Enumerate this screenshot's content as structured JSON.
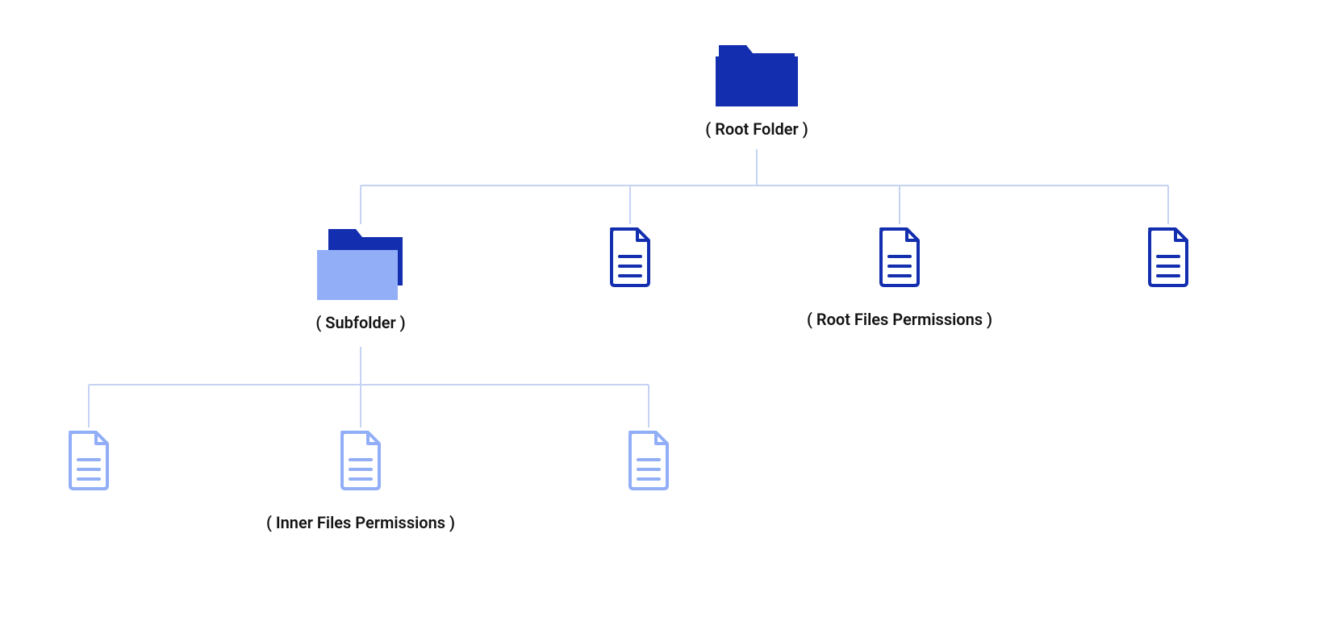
{
  "nodes": {
    "root": {
      "label": "( Root Folder )"
    },
    "subfolder": {
      "label": "( Subfolder )"
    },
    "rootFiles": {
      "label": "( Root Files Permissions )"
    },
    "innerFiles": {
      "label": "( Inner Files Permissions )"
    }
  },
  "colors": {
    "folderDark": "#132eae",
    "folderLight": "#91aef7",
    "fileDark": "#132eae",
    "fileLight": "#91aef7",
    "connector": "#c5d3f3",
    "text": "#131313"
  }
}
